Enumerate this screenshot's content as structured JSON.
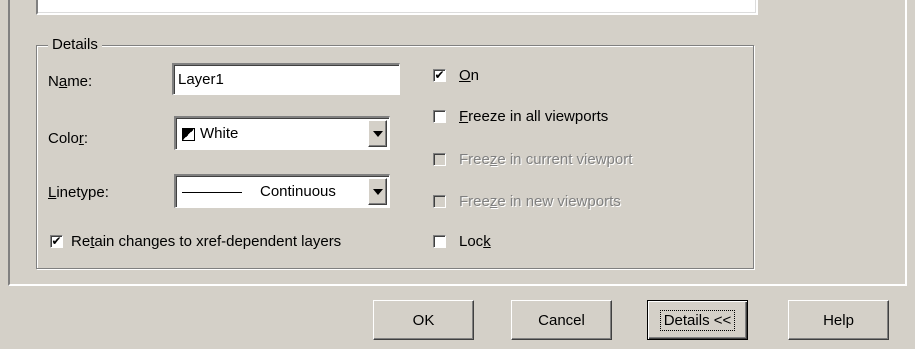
{
  "details": {
    "group_title": "Details",
    "name": {
      "label_pre": "N",
      "label_u": "a",
      "label_post": "me:",
      "value": "Layer1"
    },
    "color": {
      "label_pre": "Colo",
      "label_u": "r",
      "label_post": ":",
      "value": "White",
      "swatch_icon": "white-black-swatch-icon"
    },
    "linetype": {
      "label_pre": "",
      "label_u": "L",
      "label_post": "inetype:",
      "value": "Continuous"
    },
    "retain": {
      "label_pre": "Re",
      "label_u": "t",
      "label_post": "ain changes to xref-dependent layers",
      "checked": true
    },
    "on": {
      "label_pre": "",
      "label_u": "O",
      "label_post": "n",
      "checked": true
    },
    "freeze_all": {
      "label_pre": "",
      "label_u": "F",
      "label_post": "reeze in all viewports",
      "checked": false
    },
    "freeze_current": {
      "label_pre": "Free",
      "label_u": "z",
      "label_post": "e in current viewport",
      "checked": false,
      "enabled": false
    },
    "freeze_new": {
      "label_pre": "Free",
      "label_u": "z",
      "label_post": "e in new viewports",
      "checked": false,
      "enabled": false
    },
    "lock": {
      "label_pre": "Loc",
      "label_u": "k",
      "label_post": "",
      "checked": false
    }
  },
  "buttons": {
    "ok": "OK",
    "cancel": "Cancel",
    "details": "Details <<",
    "help": "Help"
  },
  "colors": {
    "dialog_bg": "#d4d0c8",
    "disabled_text": "#808080"
  }
}
